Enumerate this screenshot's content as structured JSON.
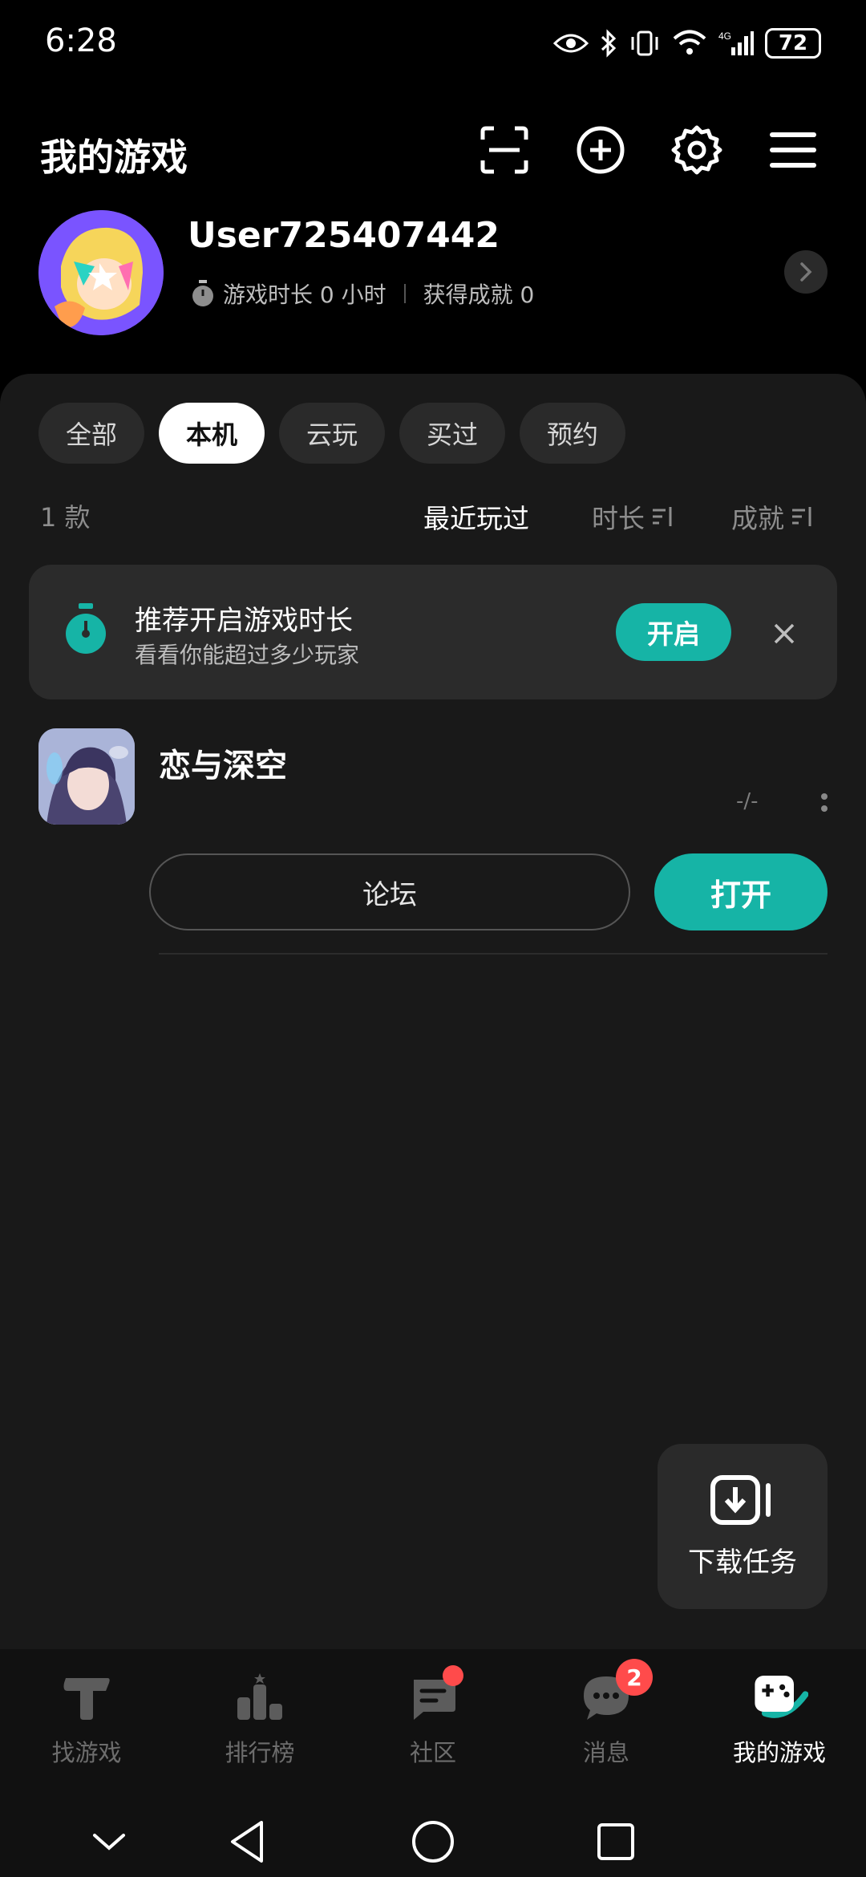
{
  "status_bar": {
    "time": "6:28",
    "battery": "72",
    "network": "4G"
  },
  "header": {
    "title": "我的游戏"
  },
  "profile": {
    "username": "User725407442",
    "play_time_label": "游戏时长 0 小时",
    "achievement_label": "获得成就 0"
  },
  "filters": {
    "tabs": [
      {
        "label": "全部",
        "active": false
      },
      {
        "label": "本机",
        "active": true
      },
      {
        "label": "云玩",
        "active": false
      },
      {
        "label": "买过",
        "active": false
      },
      {
        "label": "预约",
        "active": false
      }
    ]
  },
  "list": {
    "count": "1 款",
    "sort_options": {
      "recent": "最近玩过",
      "duration": "时长",
      "achievement": "成就"
    }
  },
  "banner": {
    "title": "推荐开启游戏时长",
    "subtitle": "看看你能超过多少玩家",
    "enable_label": "开启"
  },
  "game": {
    "name": "恋与深空",
    "playtime": "-/-",
    "forum_label": "论坛",
    "open_label": "打开"
  },
  "download_card": {
    "label": "下载任务"
  },
  "bottom_nav": {
    "items": [
      {
        "label": "找游戏",
        "icon": "find-games-icon"
      },
      {
        "label": "排行榜",
        "icon": "ranking-icon"
      },
      {
        "label": "社区",
        "icon": "community-icon"
      },
      {
        "label": "消息",
        "icon": "messages-icon",
        "badge": "2"
      },
      {
        "label": "我的游戏",
        "icon": "my-games-icon"
      }
    ]
  },
  "colors": {
    "accent": "#16b4a6",
    "background": "#191919",
    "badge_red": "#ff4b4b"
  }
}
